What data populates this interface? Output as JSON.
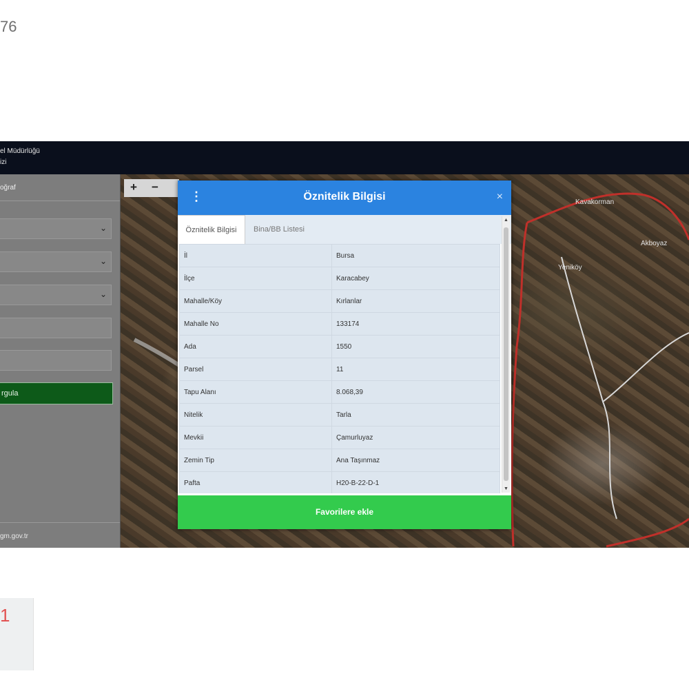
{
  "page": {
    "corner_number": "76"
  },
  "topbar": {
    "line1": "el Müdürlüğü",
    "line2": "izi"
  },
  "sidebar": {
    "heading": "oğraf",
    "query_button": "rgula",
    "footer_link": "gm.gov.tr"
  },
  "map": {
    "zoom_in": "+",
    "zoom_out": "−",
    "labels": [
      "Kavakorman",
      "Akboyaz",
      "Yeniköy"
    ]
  },
  "modal": {
    "title": "Öznitelik Bilgisi",
    "menu_icon": "⋮",
    "close_icon": "×",
    "tabs": [
      "Öznitelik Bilgisi",
      "Bina/BB Listesi"
    ],
    "rows": [
      {
        "key": "İl",
        "value": "Bursa"
      },
      {
        "key": "İlçe",
        "value": "Karacabey"
      },
      {
        "key": "Mahalle/Köy",
        "value": "Kırlanlar"
      },
      {
        "key": "Mahalle No",
        "value": "133174"
      },
      {
        "key": "Ada",
        "value": "1550"
      },
      {
        "key": "Parsel",
        "value": "11"
      },
      {
        "key": "Tapu Alanı",
        "value": "8.068,39"
      },
      {
        "key": "Nitelik",
        "value": "Tarla"
      },
      {
        "key": "Mevkii",
        "value": "Çamurluyaz"
      },
      {
        "key": "Zemin Tip",
        "value": "Ana Taşınmaz"
      },
      {
        "key": "Pafta",
        "value": "H20-B-22-D-1"
      }
    ],
    "footer_button": "Favorilere ekle"
  },
  "thumbnail": {
    "glyph": "1"
  }
}
